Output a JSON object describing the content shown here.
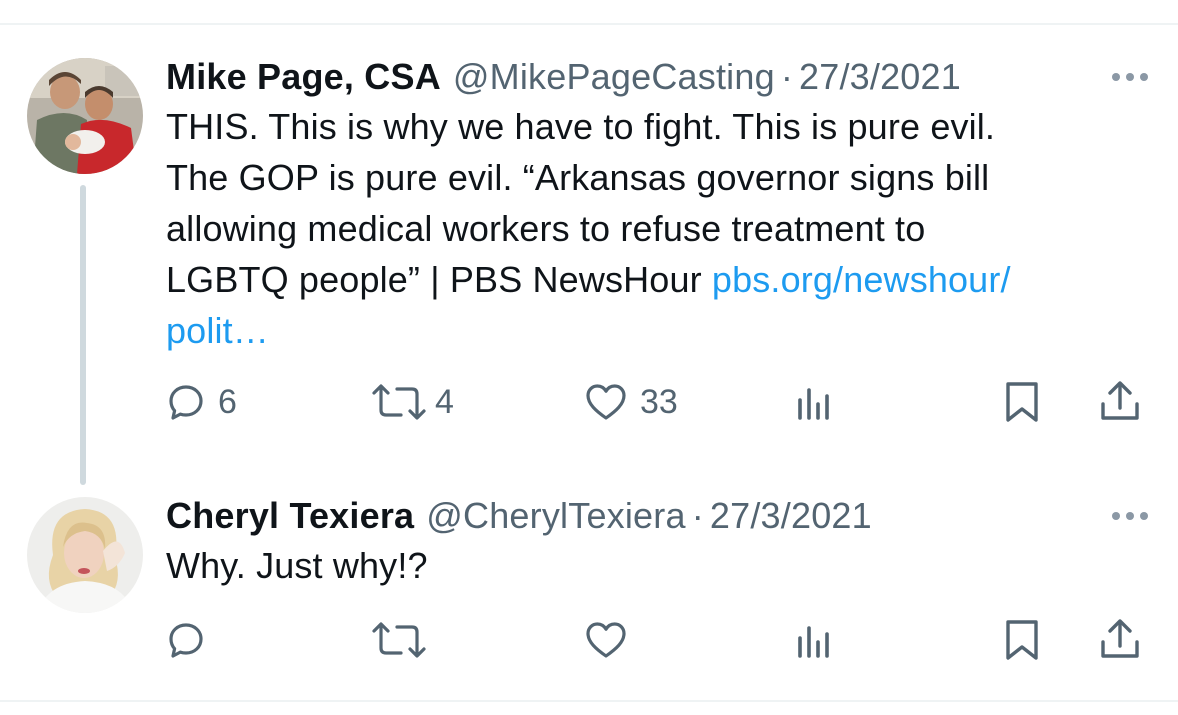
{
  "tweets": [
    {
      "name": "Mike Page, CSA",
      "handle": "@MikePageCasting",
      "separator": "·",
      "date": "27/3/2021",
      "text_lines": [
        "THIS. This is why we have to fight. This is pure evil.",
        "The GOP is pure evil. “Arkansas governor signs bill",
        "allowing medical workers to refuse treatment to",
        "LGBTQ people” | PBS NewsHour "
      ],
      "link_part1": "pbs.org/newshour/",
      "link_part2": "polit…",
      "reply_count": "6",
      "retweet_count": "4",
      "like_count": "33"
    },
    {
      "name": "Cheryl Texiera",
      "handle": "@CherylTexiera",
      "separator": "·",
      "date": "27/3/2021",
      "text": "Why. Just why!?",
      "reply_count": "",
      "retweet_count": "",
      "like_count": ""
    }
  ],
  "icons": [
    "reply-icon",
    "retweet-icon",
    "like-icon",
    "analytics-icon",
    "bookmark-icon",
    "share-icon",
    "more-icon"
  ],
  "colors": {
    "text": "#0f1419",
    "secondary": "#536471",
    "link": "#1d9bf0",
    "thread_line": "#cfd9de"
  }
}
